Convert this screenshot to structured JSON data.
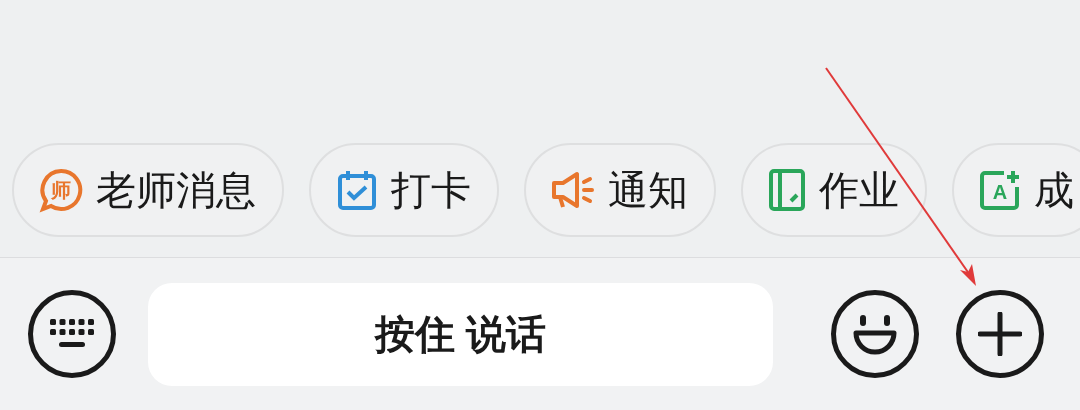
{
  "quick_actions": [
    {
      "label": "老师消息",
      "kind": "teacher",
      "icon_text": "师",
      "color": "#e8762d"
    },
    {
      "label": "打卡",
      "kind": "calendar",
      "color": "#2f8fd8"
    },
    {
      "label": "通知",
      "kind": "megaphone",
      "color": "#e8762d"
    },
    {
      "label": "作业",
      "kind": "notebook",
      "color": "#2aa65a"
    },
    {
      "label": "成",
      "kind": "grade",
      "icon_text": "A",
      "color": "#2aa65a"
    }
  ],
  "input_bar": {
    "voice_button": "按住 说话"
  },
  "annotation": {
    "kind": "arrow",
    "color": "#e03a3a"
  }
}
